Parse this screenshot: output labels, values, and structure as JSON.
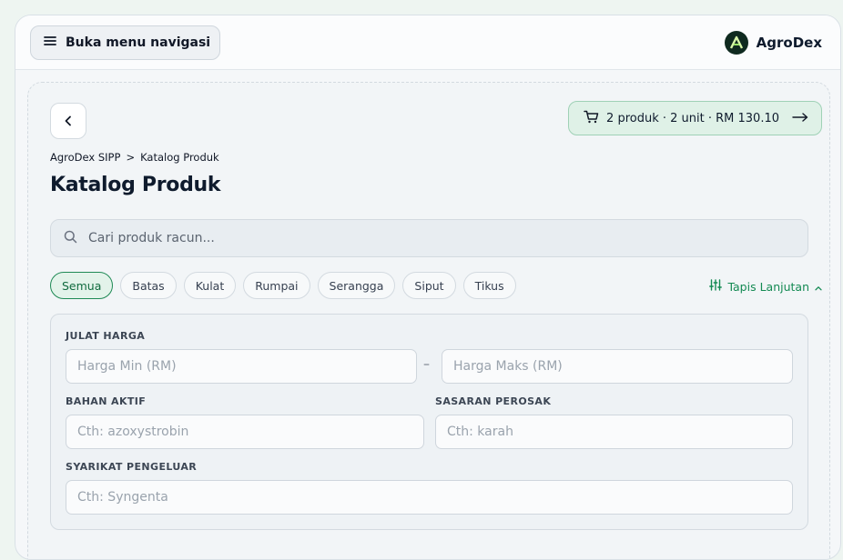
{
  "topbar": {
    "nav_button_label": "Buka menu navigasi",
    "brand_name": "AgroDex",
    "brand_logo_letter": "A"
  },
  "cart": {
    "summary": "2 produk · 2 unit · RM 130.10"
  },
  "breadcrumb": {
    "items": [
      "AgroDex SIPP",
      "Katalog Produk"
    ],
    "separator": ">"
  },
  "page_title": "Katalog Produk",
  "search": {
    "placeholder": "Cari produk racun..."
  },
  "categories": {
    "items": [
      "Semua",
      "Batas",
      "Kulat",
      "Rumpai",
      "Serangga",
      "Siput",
      "Tikus"
    ],
    "active": "Semua"
  },
  "advanced_filter": {
    "label": "Tapis Lanjutan"
  },
  "filters": {
    "price_range": {
      "label": "JULAT HARGA",
      "min_placeholder": "Harga Min (RM)",
      "max_placeholder": "Harga Maks (RM)",
      "separator": "–"
    },
    "active_ingredient": {
      "label": "BAHAN AKTIF",
      "placeholder": "Cth: azoxystrobin"
    },
    "target_pest": {
      "label": "SASARAN PEROSAK",
      "placeholder": "Cth: karah"
    },
    "manufacturer": {
      "label": "SYARIKAT PENGELUAR",
      "placeholder": "Cth: Syngenta"
    }
  },
  "colors": {
    "accent": "#148a53",
    "brand_dark": "#0f2a1f",
    "cart_bg": "#dff1e7"
  }
}
